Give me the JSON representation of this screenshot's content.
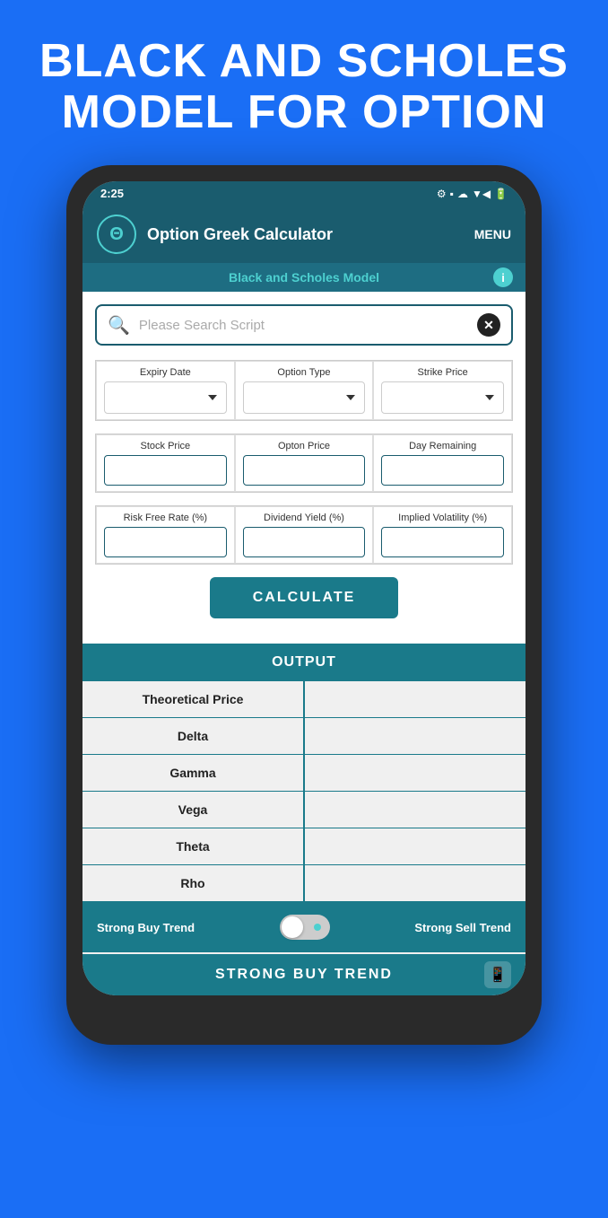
{
  "hero": {
    "title": "BLACK AND SCHOLES MODEL FOR OPTION"
  },
  "statusBar": {
    "time": "2:25",
    "icons": "⚙ 📶 ☁ ▼◀ 🔋"
  },
  "header": {
    "logo": "Θ",
    "title": "Option Greek Calculator",
    "menu": "MENU"
  },
  "subtitle": {
    "text": "Black and Scholes Model",
    "infoIcon": "i"
  },
  "search": {
    "placeholder": "Please Search Script",
    "clearIcon": "✕"
  },
  "form": {
    "expiryDate": {
      "label": "Expiry Date"
    },
    "optionType": {
      "label": "Option Type"
    },
    "strikePrice": {
      "label": "Strike Price"
    },
    "stockPrice": {
      "label": "Stock Price"
    },
    "optonPrice": {
      "label": "Opton Price"
    },
    "dayRemaining": {
      "label": "Day Remaining"
    },
    "riskFreeRate": {
      "label": "Risk Free Rate (%)"
    },
    "dividendYield": {
      "label": "Dividend Yield (%)"
    },
    "impliedVolatility": {
      "label": "Implied Volatility (%)"
    }
  },
  "calculateButton": {
    "label": "CALCULATE"
  },
  "output": {
    "header": "OUTPUT",
    "rows": [
      {
        "label": "Theoretical Price",
        "value": ""
      },
      {
        "label": "Delta",
        "value": ""
      },
      {
        "label": "Gamma",
        "value": ""
      },
      {
        "label": "Vega",
        "value": ""
      },
      {
        "label": "Theta",
        "value": ""
      },
      {
        "label": "Rho",
        "value": ""
      }
    ]
  },
  "toggle": {
    "buyLabel": "Strong Buy Trend",
    "sellLabel": "Strong Sell Trend"
  },
  "trendBar": {
    "label": "STRONG BUY TREND"
  }
}
